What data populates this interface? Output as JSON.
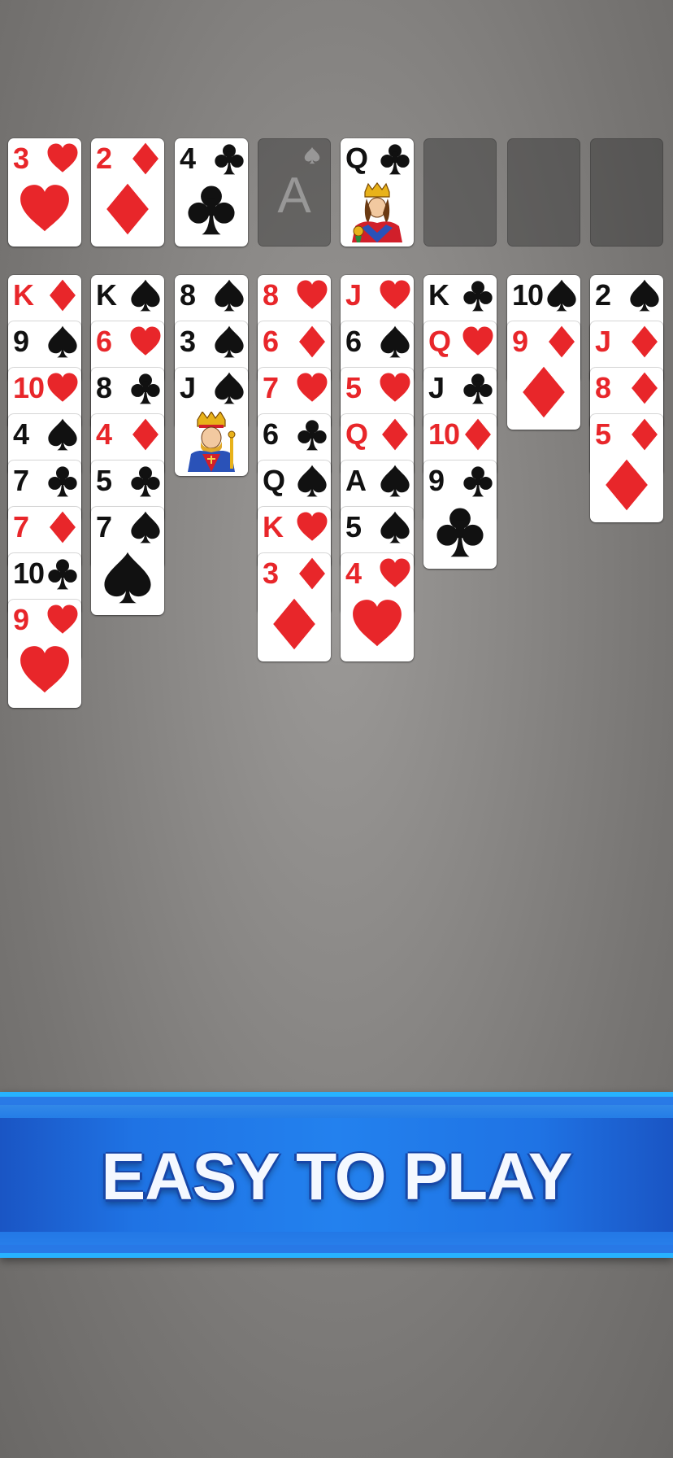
{
  "colors": {
    "red_suit": "#e8262a",
    "black_suit": "#111111",
    "felt": "#8a8886",
    "banner_blue": "#1f73e4",
    "banner_edge": "#27b2ff"
  },
  "free_cells": [
    {
      "rank": "3",
      "suit": "hearts"
    },
    {
      "rank": "2",
      "suit": "diamonds"
    },
    {
      "rank": "4",
      "suit": "clubs"
    },
    {
      "empty": true,
      "placeholder": "A",
      "suit": "spades"
    }
  ],
  "foundations": [
    {
      "rank": "Q",
      "suit": "clubs"
    },
    {
      "empty": true
    },
    {
      "empty": true
    },
    {
      "empty": true
    }
  ],
  "tableau": [
    [
      {
        "rank": "K",
        "suit": "diamonds"
      },
      {
        "rank": "9",
        "suit": "spades"
      },
      {
        "rank": "10",
        "suit": "hearts"
      },
      {
        "rank": "4",
        "suit": "spades"
      },
      {
        "rank": "7",
        "suit": "clubs"
      },
      {
        "rank": "7",
        "suit": "diamonds"
      },
      {
        "rank": "10",
        "suit": "clubs"
      },
      {
        "rank": "9",
        "suit": "hearts"
      }
    ],
    [
      {
        "rank": "K",
        "suit": "spades"
      },
      {
        "rank": "6",
        "suit": "hearts"
      },
      {
        "rank": "8",
        "suit": "clubs"
      },
      {
        "rank": "4",
        "suit": "diamonds"
      },
      {
        "rank": "5",
        "suit": "clubs"
      },
      {
        "rank": "7",
        "suit": "spades"
      }
    ],
    [
      {
        "rank": "8",
        "suit": "spades"
      },
      {
        "rank": "3",
        "suit": "spades"
      },
      {
        "rank": "J",
        "suit": "spades"
      }
    ],
    [
      {
        "rank": "8",
        "suit": "hearts"
      },
      {
        "rank": "6",
        "suit": "diamonds"
      },
      {
        "rank": "7",
        "suit": "hearts"
      },
      {
        "rank": "6",
        "suit": "clubs"
      },
      {
        "rank": "Q",
        "suit": "spades"
      },
      {
        "rank": "K",
        "suit": "hearts"
      },
      {
        "rank": "3",
        "suit": "diamonds"
      }
    ],
    [
      {
        "rank": "J",
        "suit": "hearts"
      },
      {
        "rank": "6",
        "suit": "spades"
      },
      {
        "rank": "5",
        "suit": "hearts"
      },
      {
        "rank": "Q",
        "suit": "diamonds"
      },
      {
        "rank": "A",
        "suit": "spades"
      },
      {
        "rank": "5",
        "suit": "spades"
      },
      {
        "rank": "4",
        "suit": "hearts"
      }
    ],
    [
      {
        "rank": "K",
        "suit": "clubs"
      },
      {
        "rank": "Q",
        "suit": "hearts"
      },
      {
        "rank": "J",
        "suit": "clubs"
      },
      {
        "rank": "10",
        "suit": "diamonds"
      },
      {
        "rank": "9",
        "suit": "clubs"
      }
    ],
    [
      {
        "rank": "10",
        "suit": "spades"
      },
      {
        "rank": "9",
        "suit": "diamonds"
      }
    ],
    [
      {
        "rank": "2",
        "suit": "spades"
      },
      {
        "rank": "J",
        "suit": "diamonds"
      },
      {
        "rank": "8",
        "suit": "diamonds"
      },
      {
        "rank": "5",
        "suit": "diamonds"
      }
    ]
  ],
  "banner": {
    "text": "EASY TO PLAY"
  }
}
